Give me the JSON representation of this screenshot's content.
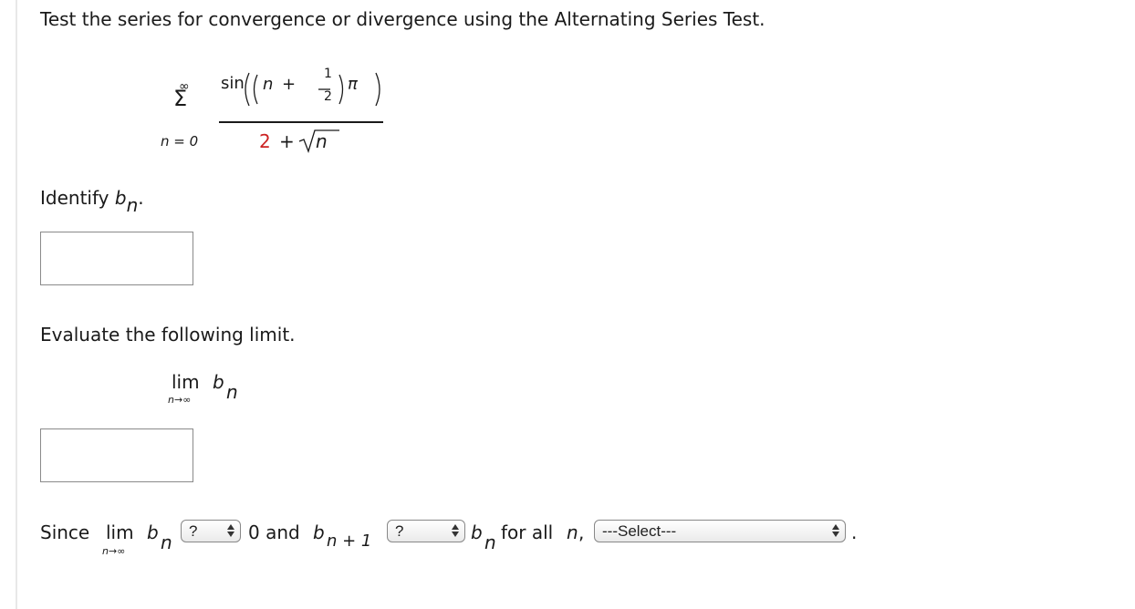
{
  "prompt": "Test the series for convergence or divergence using the Alternating Series Test.",
  "series": {
    "sum_upper": "∞",
    "sum_symbol": "Σ",
    "sum_lower": "n = 0",
    "numerator_func": "sin",
    "numerator_n": "n",
    "numerator_plus": "+",
    "numerator_frac_num": "1",
    "numerator_frac_den": "2",
    "numerator_pi": "π",
    "denominator_const": "2",
    "denominator_plus": "+",
    "denominator_n": "n"
  },
  "identify": {
    "label": "Identify",
    "var": "b",
    "sub": "n",
    "period": "."
  },
  "evaluate": {
    "label": "Evaluate the following limit.",
    "lim": "lim",
    "lim_sub": "n→∞",
    "var": "b",
    "var_sub": "n"
  },
  "conclusion": {
    "since": "Since",
    "lim": "lim",
    "lim_sub": "n→∞",
    "var": "b",
    "var_sub": "n",
    "select1": "?",
    "zero_and": "0 and",
    "var2": "b",
    "var2_sub": "n + 1",
    "select2": "?",
    "var3": "b",
    "var3_sub": "n",
    "for_all": "for all",
    "n": "n",
    "comma": ",",
    "select3": "---Select---",
    "end": "."
  }
}
